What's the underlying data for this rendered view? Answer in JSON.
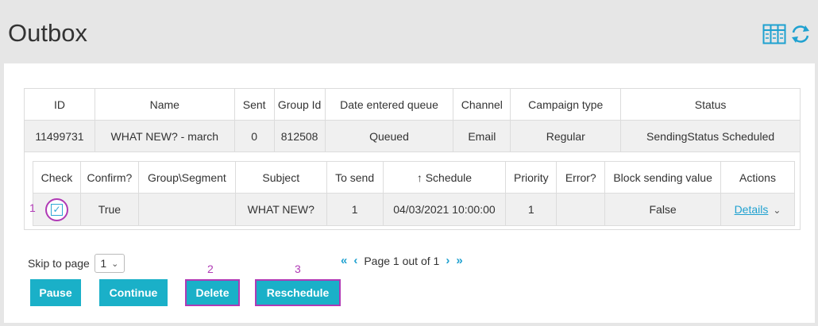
{
  "page": {
    "title": "Outbox"
  },
  "icons": {
    "columns": "columns-icon",
    "refresh": "refresh-icon",
    "accent": "#1fa1d0"
  },
  "queue_table": {
    "headers": [
      "ID",
      "Name",
      "Sent",
      "Group Id",
      "Date entered queue",
      "Channel",
      "Campaign type",
      "Status"
    ],
    "row": [
      "11499731",
      "WHAT NEW? - march",
      "0",
      "812508",
      "Queued",
      "Email",
      "Regular",
      "SendingStatus Scheduled"
    ]
  },
  "detail_table": {
    "headers": [
      "Check",
      "Confirm?",
      "Group\\Segment",
      "Subject",
      "To send",
      "↑ Schedule",
      "Priority",
      "Error?",
      "Block sending value",
      "Actions"
    ],
    "row": {
      "step": "1",
      "check_mark": "✓",
      "confirm": "True",
      "group": "",
      "subject": "WHAT NEW?",
      "to_send": "1",
      "schedule": "04/03/2021 10:00:00",
      "priority": "1",
      "error": "",
      "block_sending": "False",
      "details_label": "Details",
      "chevron": "⌄"
    }
  },
  "paging": {
    "skip_label": "Skip to page",
    "page_value": "1",
    "page_text": "Page 1 out of 1",
    "first": "«",
    "prev": "‹",
    "next": "›",
    "last": "»"
  },
  "buttons": {
    "pause": "Pause",
    "continue": "Continue",
    "delete": "Delete",
    "reschedule": "Reschedule"
  },
  "step_labels": {
    "delete": "2",
    "reschedule": "3"
  },
  "colors": {
    "highlight": "#b03ab5",
    "button": "#1ab0c8"
  }
}
